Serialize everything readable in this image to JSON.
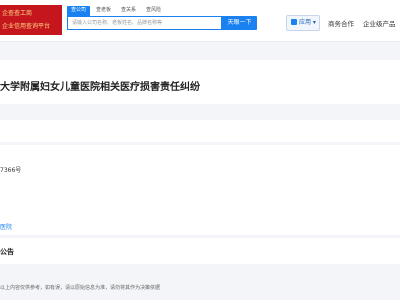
{
  "header": {
    "logo_lines": [
      "企查查工商",
      "企业信用查询平台"
    ],
    "search_tabs": [
      "查公司",
      "查老板",
      "查关系",
      "查风险"
    ],
    "search_placeholder": "请输入公司名称、老板姓名、品牌名称等",
    "search_button": "天眼一下",
    "app_button": "应用",
    "nav_links": [
      "商务合作",
      "企业级产品"
    ]
  },
  "page": {
    "title": "大学附属妇女儿童医院相关医疗损害责任纠纷",
    "case_number": "7366号",
    "hospital_link": "医院",
    "notice_title": "公告",
    "disclaimer": "以上内容仅供参考，如有误，请以原始信息为准，请勿将其作为决策依据"
  }
}
